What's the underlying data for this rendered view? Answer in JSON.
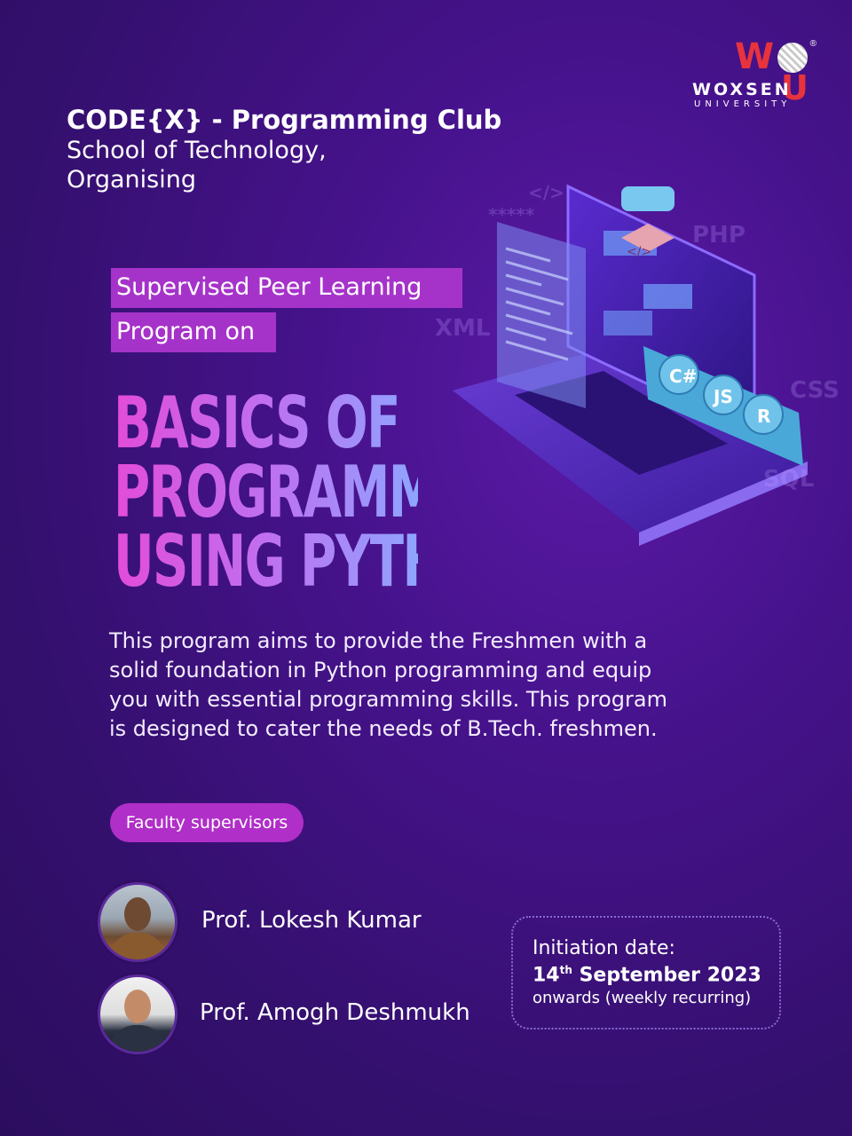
{
  "logo": {
    "brand": "WOXSEN",
    "sub": "UNIVERSITY",
    "reg": "®"
  },
  "header": {
    "club": "CODE{X} - Programming Club",
    "school": "School of Technology,",
    "organising": "Organising"
  },
  "program_label": {
    "line1": "Supervised Peer Learning",
    "line2": "Program on"
  },
  "title": {
    "line1": "BASICS OF",
    "line2": "PROGRAMMING",
    "line3": "USING PYTHON"
  },
  "description": "This program aims to provide the Freshmen with a solid foundation in Python programming and equip you with essential programming skills. This program is designed to cater the needs of B.Tech. freshmen.",
  "faculty_label": "Faculty supervisors",
  "professors": [
    {
      "name": "Prof. Lokesh Kumar"
    },
    {
      "name": "Prof. Amogh Deshmukh"
    }
  ],
  "initiation": {
    "label": "Initiation date:",
    "day": "14",
    "suffix": "th",
    "month_year": " September 2023",
    "note": "onwards (weekly recurring)"
  },
  "illustration": {
    "code_tags": [
      "C#",
      "JS",
      "R"
    ],
    "watermarks": [
      "PHP",
      "XML",
      "CSS",
      "SQL",
      "</>",
      "*****"
    ],
    "chip_icon": "</>"
  },
  "colors": {
    "background": "#3a1078",
    "accent_pink": "#a633c9",
    "logo_red": "#e8333d"
  }
}
